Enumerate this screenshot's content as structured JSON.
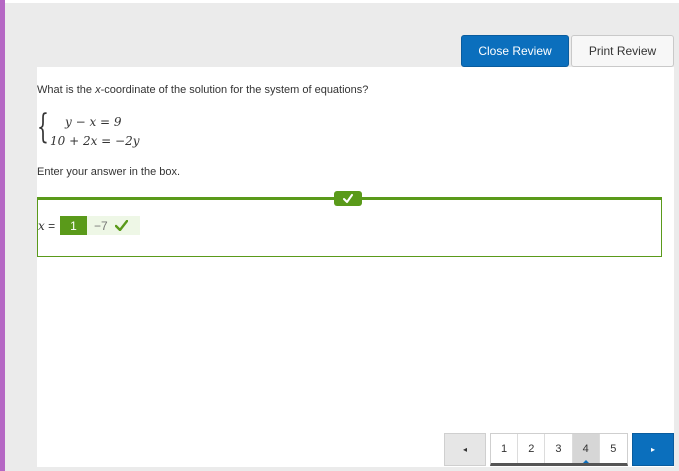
{
  "toolbar": {
    "close_review_label": "Close Review",
    "print_review_label": "Print Review"
  },
  "question": {
    "prompt_before": "What is the ",
    "prompt_var": "x",
    "prompt_after": "-coordinate of the solution for the system of equations?",
    "equations": [
      "y − x = 9",
      "10 + 2x = −2y"
    ],
    "instruction": "Enter your answer in the box."
  },
  "answer": {
    "label_var": "x",
    "label_equals": " =",
    "given_value": "1",
    "correct_value": "−7",
    "status": "correct"
  },
  "pagination": {
    "prev_symbol": "◂",
    "next_symbol": "▸",
    "pages": [
      "1",
      "2",
      "3",
      "4",
      "5"
    ],
    "current_page": "4"
  },
  "colors": {
    "accent_left": "#b567c4",
    "primary_blue": "#0b6fbd",
    "correct_green": "#5a9a1a",
    "correct_bg": "#eef7e6"
  }
}
